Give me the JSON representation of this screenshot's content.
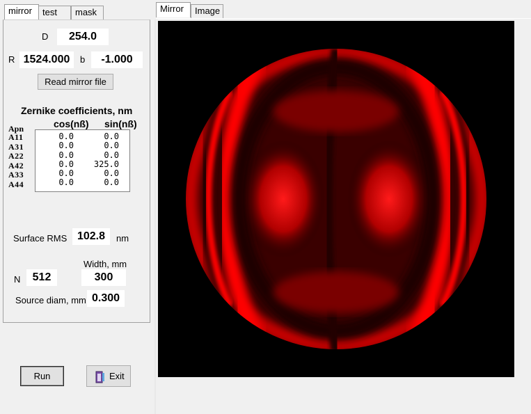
{
  "left_tabs": [
    "mirror",
    "test",
    "mask"
  ],
  "right_tabs": [
    "Mirror",
    "Image"
  ],
  "mirror": {
    "D_label": "D",
    "D_value": "254.0",
    "R_label": "R",
    "R_value": "1524.000",
    "b_label": "b",
    "b_value": "-1.000",
    "read_button": "Read mirror file"
  },
  "zernike": {
    "title": "Zernike coefficients, nm",
    "apn_header": "Apn",
    "cos_header": "cos(nß)",
    "sin_header": "sin(nß)",
    "rows": [
      {
        "name": "A11",
        "cos": "0.0",
        "sin": "0.0"
      },
      {
        "name": "A31",
        "cos": "0.0",
        "sin": "0.0"
      },
      {
        "name": "A22",
        "cos": "0.0",
        "sin": "0.0"
      },
      {
        "name": "A42",
        "cos": "0.0",
        "sin": "325.0"
      },
      {
        "name": "A33",
        "cos": "0.0",
        "sin": "0.0"
      },
      {
        "name": "A44",
        "cos": "0.0",
        "sin": "0.0"
      }
    ]
  },
  "surface": {
    "label": "Surface RMS",
    "value": "102.8",
    "unit": "nm"
  },
  "width": {
    "label": "Width, mm",
    "value": "300"
  },
  "n": {
    "label": "N",
    "value": "512"
  },
  "source": {
    "label": "Source diam, mm",
    "value": "0.300"
  },
  "buttons": {
    "run": "Run",
    "exit": "Exit"
  },
  "colors": {
    "fringe": "#ff0000",
    "background": "#000000"
  }
}
